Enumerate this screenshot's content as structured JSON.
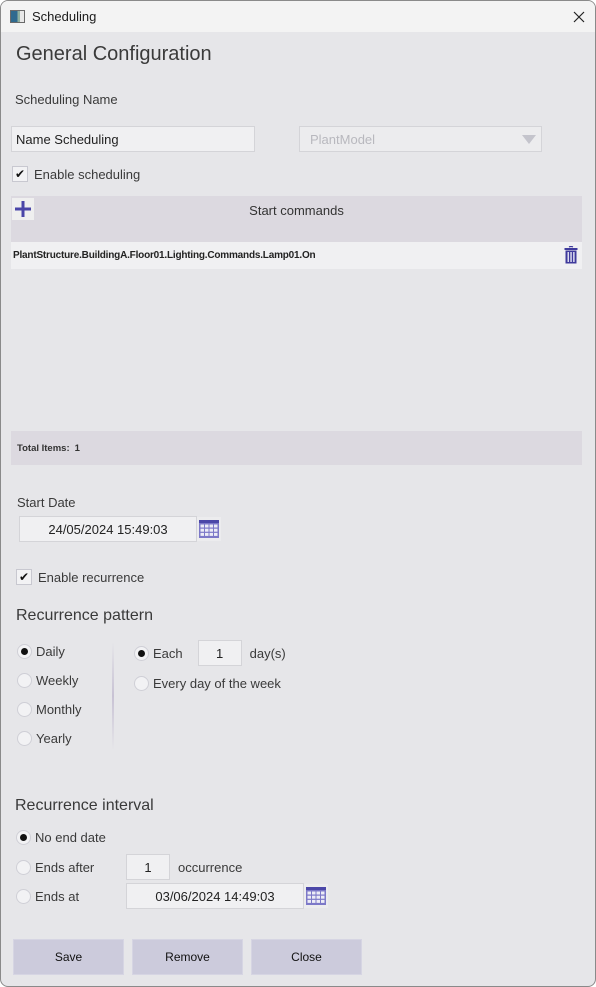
{
  "window": {
    "title": "Scheduling",
    "icon": "app-window-icon",
    "close_icon": "close-icon"
  },
  "general": {
    "heading": "General Configuration",
    "name_label": "Scheduling Name",
    "name_value": "Name Scheduling",
    "model_combo": {
      "selected": "PlantModel",
      "enabled": false
    },
    "enable_scheduling": {
      "label": "Enable scheduling",
      "checked": true
    }
  },
  "start_commands": {
    "title": "Start commands",
    "add_icon": "plus-icon",
    "items": [
      {
        "command": "PlantStructure.BuildingA.Floor01.Lighting.Commands.Lamp01.On",
        "delete_icon": "trash-icon"
      }
    ],
    "total_label": "Total Items:",
    "total_value": "1"
  },
  "start_date": {
    "label": "Start Date",
    "value": "24/05/2024 15:49:03",
    "calendar_icon": "calendar-icon"
  },
  "enable_recurrence": {
    "label": "Enable recurrence",
    "checked": true
  },
  "recurrence_pattern": {
    "heading": "Recurrence pattern",
    "options": [
      {
        "label": "Daily",
        "selected": true
      },
      {
        "label": "Weekly",
        "selected": false
      },
      {
        "label": "Monthly",
        "selected": false
      },
      {
        "label": "Yearly",
        "selected": false
      }
    ],
    "daily": {
      "each_label": "Each",
      "each_selected": true,
      "each_value": "1",
      "unit_label": "day(s)",
      "every_weekday_label": "Every day of the week",
      "every_weekday_selected": false
    }
  },
  "recurrence_interval": {
    "heading": "Recurrence interval",
    "no_end": {
      "label": "No end date",
      "selected": true
    },
    "ends_after": {
      "label": "Ends after",
      "selected": false,
      "value": "1",
      "unit_label": "occurrence"
    },
    "ends_at": {
      "label": "Ends at",
      "selected": false,
      "value": "03/06/2024 14:49:03"
    }
  },
  "buttons": {
    "save": "Save",
    "remove": "Remove",
    "close": "Close"
  }
}
